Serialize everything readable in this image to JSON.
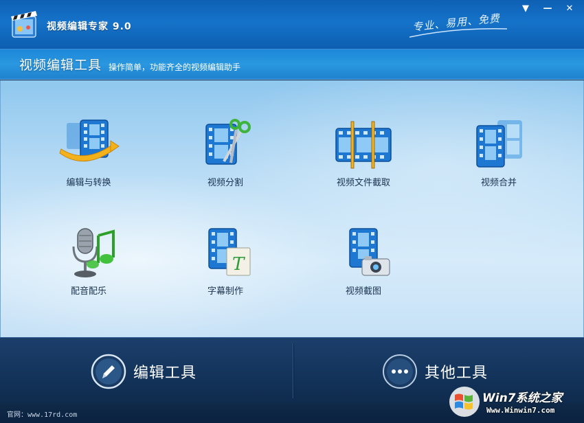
{
  "window": {
    "title": "视频编辑专家 9.0",
    "slogan": "专业、易用、免费",
    "buttons": {
      "menu": "▼",
      "minimize": "—",
      "close": "✕"
    }
  },
  "header": {
    "title": "视频编辑工具",
    "subtitle": "操作简单，功能齐全的视频编辑助手"
  },
  "tools": [
    {
      "label": "编辑与转换",
      "icon": "film-convert-icon"
    },
    {
      "label": "视频分割",
      "icon": "film-scissors-icon"
    },
    {
      "label": "视频文件截取",
      "icon": "film-trim-icon"
    },
    {
      "label": "视频合并",
      "icon": "film-merge-icon"
    },
    {
      "label": "配音配乐",
      "icon": "microphone-music-icon"
    },
    {
      "label": "字幕制作",
      "icon": "film-subtitle-icon"
    },
    {
      "label": "视频截图",
      "icon": "film-camera-icon"
    }
  ],
  "bottom_tabs": [
    {
      "label": "编辑工具",
      "icon": "pencil-icon",
      "active": true
    },
    {
      "label": "其他工具",
      "icon": "more-dots-icon",
      "active": false
    }
  ],
  "status": {
    "website": "官网：www.17rd.com",
    "watermark_brand": "Win7系统之家",
    "watermark_url": "Www.Winwin7.com"
  },
  "colors": {
    "title_bar": "#1573c9",
    "header_band": "#2a97e0",
    "content_bg": "#c6e1f6",
    "bottom_bar": "#14355d",
    "film_blue": "#1e78d2",
    "label_text": "#1b3350"
  }
}
